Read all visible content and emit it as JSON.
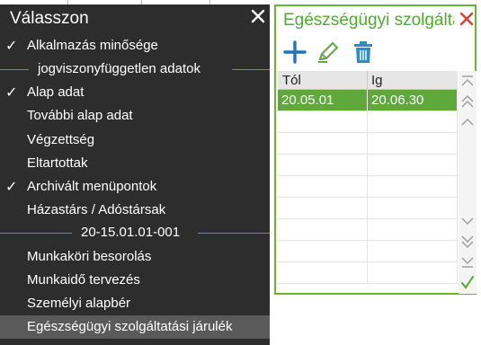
{
  "menu": {
    "title": "Válasszon",
    "items": [
      {
        "label": "Alkalmazás minősége",
        "checked": true
      },
      {
        "label": "jogviszonyfüggetlen adatok",
        "separator": true
      },
      {
        "label": "Alap adat",
        "checked": true
      },
      {
        "label": "További alap adat",
        "checked": false
      },
      {
        "label": "Végzettség",
        "checked": false
      },
      {
        "label": "Eltartottak",
        "checked": false
      },
      {
        "label": "Archivált menüpontok",
        "checked": true
      },
      {
        "label": "Házastárs / Adóstársak",
        "checked": false
      },
      {
        "label": "20-15.01.01-001",
        "separator": true
      },
      {
        "label": "Munkaköri besorolás",
        "checked": false
      },
      {
        "label": "Munkaidő tervezés",
        "checked": false
      },
      {
        "label": "Személyi alapbér",
        "checked": false
      },
      {
        "label": "Egészségügyi szolgáltatási járulék",
        "checked": false,
        "selected": true
      }
    ],
    "check_glyph": "✓"
  },
  "dialog": {
    "title": "Egészségügyi szolgáltatási járulék",
    "toolbar": {
      "add_icon": "plus-icon",
      "edit_icon": "pencil-icon",
      "delete_icon": "trash-icon"
    },
    "columns": [
      "Tól",
      "Ig"
    ],
    "rows": [
      {
        "from": "20.05.01",
        "to": "20.06.30",
        "selected": true
      }
    ]
  },
  "colors": {
    "accent": "#4caf2c",
    "selected_row": "#5fa83b",
    "menu_bg": "#2d2d2d",
    "close_red": "#e53935",
    "icon_blue": "#1e73be",
    "edit_green": "#6aa84f",
    "trash_blue": "#2a8fc9"
  }
}
